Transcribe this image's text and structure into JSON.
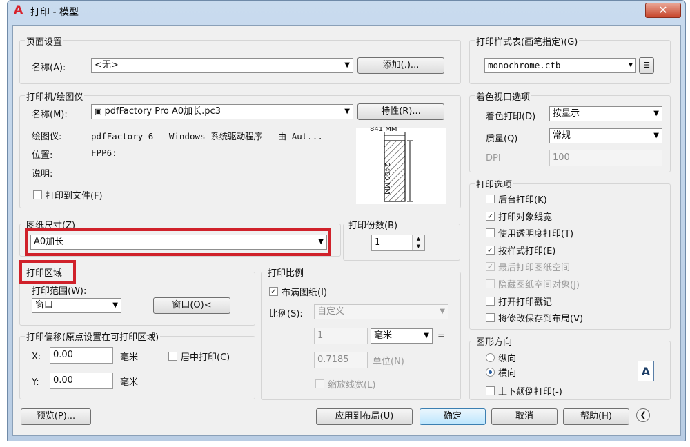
{
  "window": {
    "title": "打印 - 模型",
    "close_glyph": "✕"
  },
  "page_setup": {
    "title": "页面设置",
    "name_label": "名称(A):",
    "name_value": "<无>",
    "add_button": "添加(.)..."
  },
  "printer": {
    "title": "打印机/绘图仪",
    "name_label": "名称(M):",
    "name_value": "pdfFactory Pro A0加长.pc3",
    "properties_button": "特性(R)...",
    "plotter_label": "绘图仪:",
    "plotter_value": "pdfFactory 6 - Windows 系统驱动程序 - 由 Aut...",
    "location_label": "位置:",
    "location_value": "FPP6:",
    "description_label": "说明:",
    "print_to_file_label": "打印到文件(F)",
    "print_to_file_checked": false,
    "preview_width_label": "841 MM",
    "preview_height_label": "2400 MM"
  },
  "paper_size": {
    "title": "图纸尺寸(Z)",
    "value": "A0加长"
  },
  "copies": {
    "title": "打印份数(B)",
    "value": "1"
  },
  "plot_area": {
    "title": "打印区域",
    "range_label": "打印范围(W):",
    "range_value": "窗口",
    "window_button": "窗口(O)<"
  },
  "plot_scale": {
    "title": "打印比例",
    "fit_label": "布满图纸(I)",
    "fit_checked": true,
    "scale_label": "比例(S):",
    "scale_value": "自定义",
    "value1": "1",
    "unit_value": "毫米",
    "equals": "=",
    "value2": "0.7185",
    "unit_label": "单位(N)",
    "lineweights_label": "缩放线宽(L)"
  },
  "plot_offset": {
    "title": "打印偏移(原点设置在可打印区域)",
    "x_label": "X:",
    "x_value": "0.00",
    "x_unit": "毫米",
    "center_label": "居中打印(C)",
    "y_label": "Y:",
    "y_value": "0.00",
    "y_unit": "毫米"
  },
  "plot_style": {
    "title": "打印样式表(画笔指定)(G)",
    "value": "monochrome.ctb"
  },
  "shaded": {
    "title": "着色视口选项",
    "shade_label": "着色打印(D)",
    "shade_value": "按显示",
    "quality_label": "质量(Q)",
    "quality_value": "常规",
    "dpi_label": "DPI",
    "dpi_value": "100"
  },
  "plot_options": {
    "title": "打印选项",
    "items": [
      {
        "label": "后台打印(K)",
        "checked": false,
        "disabled": false
      },
      {
        "label": "打印对象线宽",
        "checked": true,
        "disabled": false
      },
      {
        "label": "使用透明度打印(T)",
        "checked": false,
        "disabled": false
      },
      {
        "label": "按样式打印(E)",
        "checked": true,
        "disabled": false
      },
      {
        "label": "最后打印图纸空间",
        "checked": true,
        "disabled": true
      },
      {
        "label": "隐藏图纸空间对象(J)",
        "checked": false,
        "disabled": true
      },
      {
        "label": "打开打印戳记",
        "checked": false,
        "disabled": false
      },
      {
        "label": "将修改保存到布局(V)",
        "checked": false,
        "disabled": false
      }
    ]
  },
  "orientation": {
    "title": "图形方向",
    "portrait_label": "纵向",
    "landscape_label": "横向",
    "selected": "横向",
    "upside_down_label": "上下颠倒打印(-)",
    "preview_letter": "A"
  },
  "footer": {
    "preview_button": "预览(P)...",
    "apply_button": "应用到布局(U)",
    "ok_button": "确定",
    "cancel_button": "取消",
    "help_button": "帮助(H)"
  },
  "colors": {
    "highlight": "#d0212a",
    "close": "#c7452b"
  }
}
